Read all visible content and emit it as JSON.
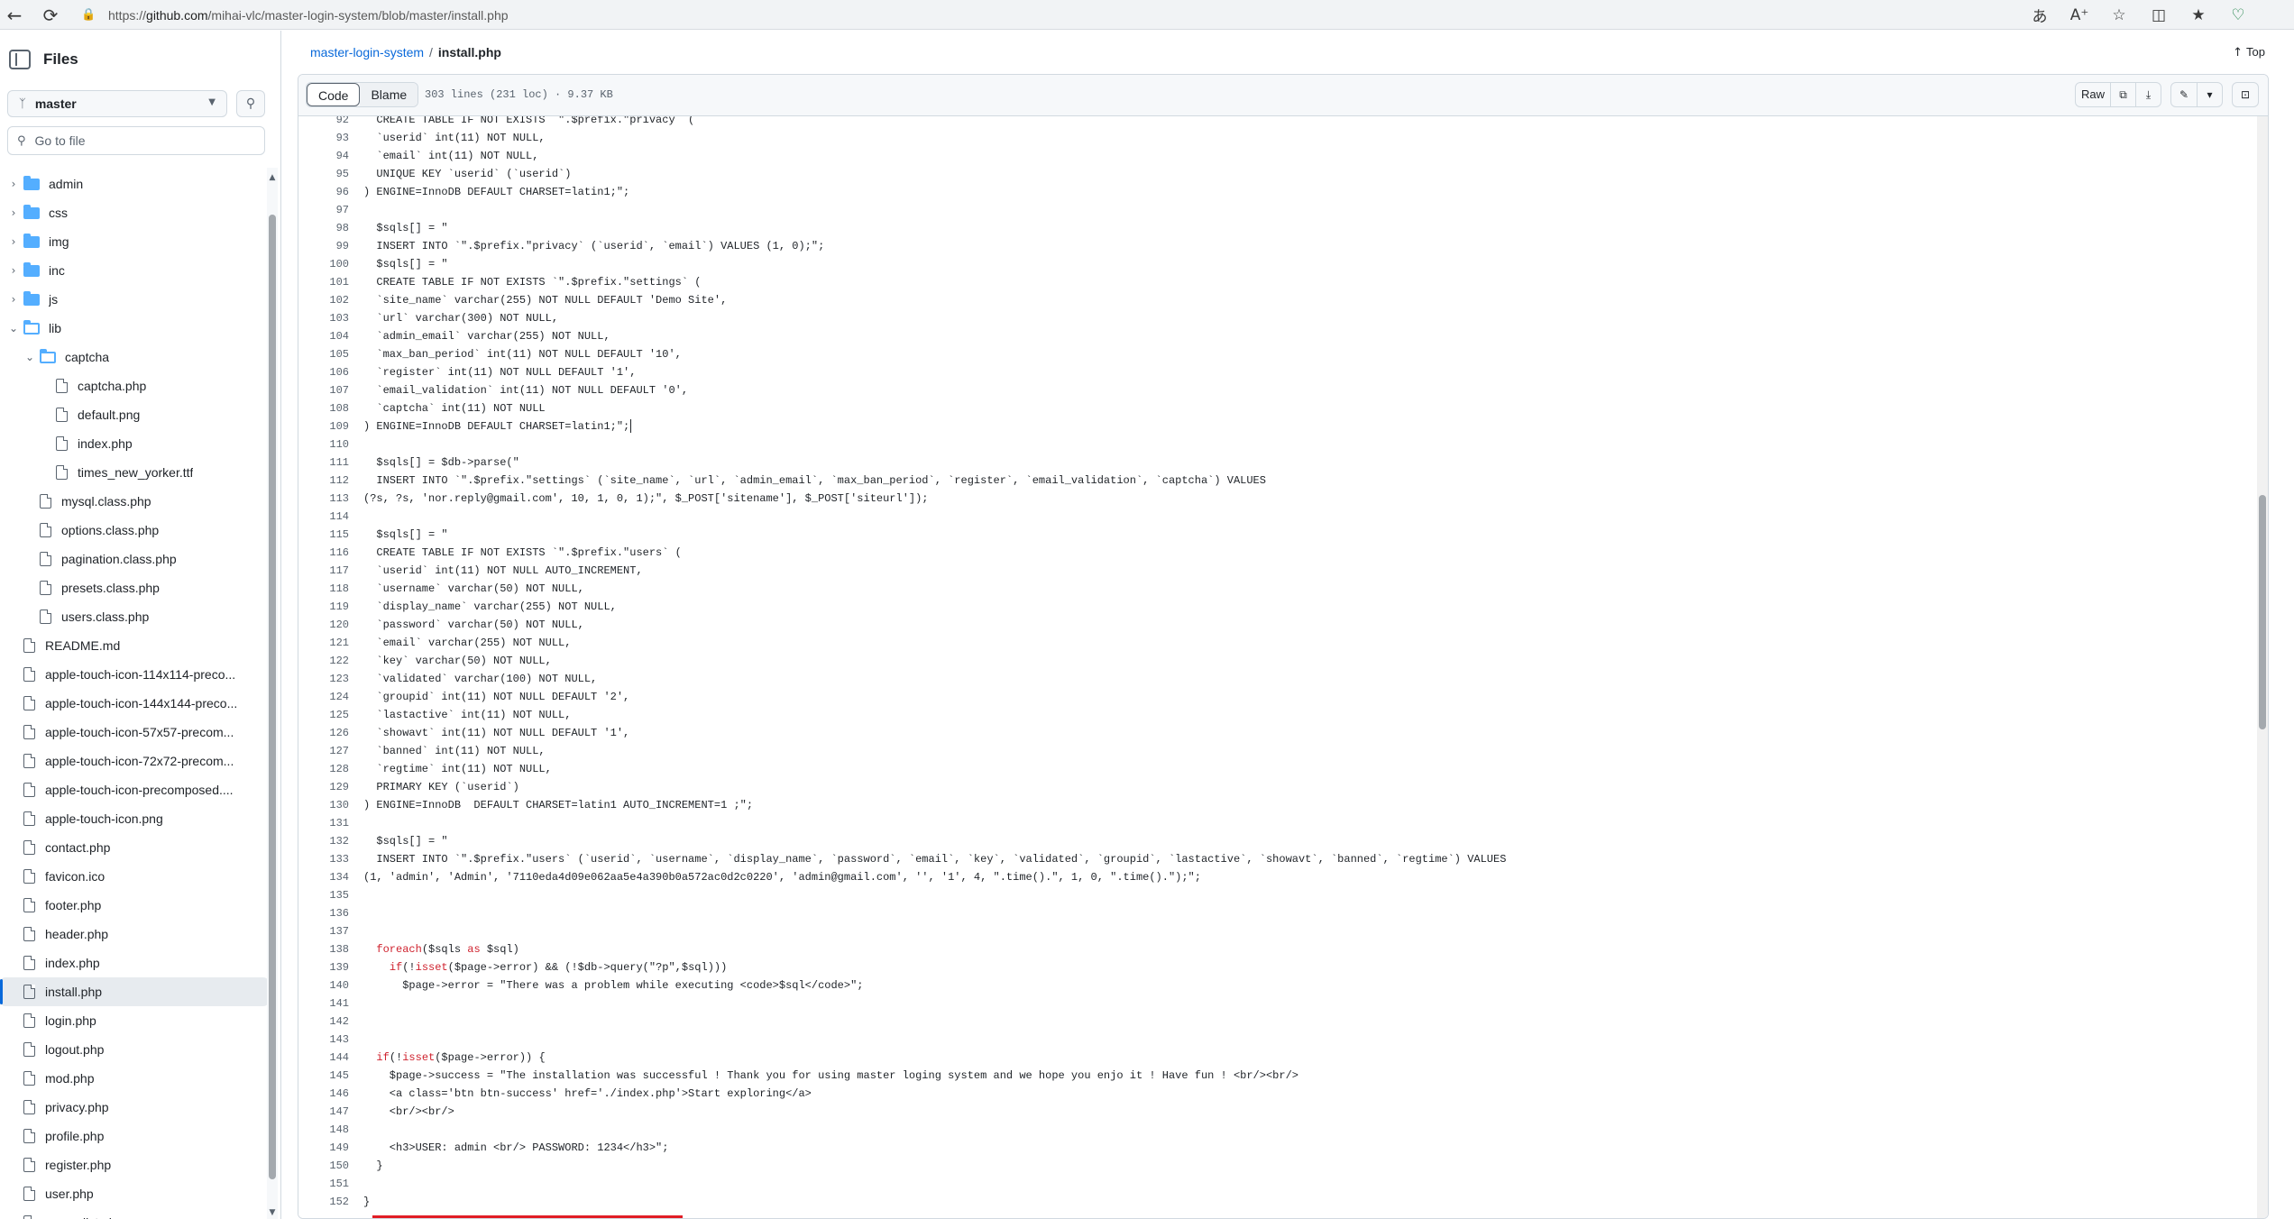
{
  "browser": {
    "url_prefix": "https://",
    "url_host": "github.com",
    "url_path": "/mihai-vlc/master-login-system/blob/master/install.php"
  },
  "sidebar": {
    "title": "Files",
    "branch": "master",
    "goto_placeholder": "Go to file",
    "items": [
      {
        "label": "admin",
        "type": "folder",
        "depth": 0,
        "expanded": false
      },
      {
        "label": "css",
        "type": "folder",
        "depth": 0,
        "expanded": false
      },
      {
        "label": "img",
        "type": "folder",
        "depth": 0,
        "expanded": false
      },
      {
        "label": "inc",
        "type": "folder",
        "depth": 0,
        "expanded": false
      },
      {
        "label": "js",
        "type": "folder",
        "depth": 0,
        "expanded": false
      },
      {
        "label": "lib",
        "type": "folder",
        "depth": 0,
        "expanded": true
      },
      {
        "label": "captcha",
        "type": "folder",
        "depth": 1,
        "expanded": true
      },
      {
        "label": "captcha.php",
        "type": "file",
        "depth": 2
      },
      {
        "label": "default.png",
        "type": "file",
        "depth": 2
      },
      {
        "label": "index.php",
        "type": "file",
        "depth": 2
      },
      {
        "label": "times_new_yorker.ttf",
        "type": "file",
        "depth": 2
      },
      {
        "label": "mysql.class.php",
        "type": "file",
        "depth": 1
      },
      {
        "label": "options.class.php",
        "type": "file",
        "depth": 1
      },
      {
        "label": "pagination.class.php",
        "type": "file",
        "depth": 1
      },
      {
        "label": "presets.class.php",
        "type": "file",
        "depth": 1
      },
      {
        "label": "users.class.php",
        "type": "file",
        "depth": 1
      },
      {
        "label": "README.md",
        "type": "file",
        "depth": 0
      },
      {
        "label": "apple-touch-icon-114x114-preco...",
        "type": "file",
        "depth": 0
      },
      {
        "label": "apple-touch-icon-144x144-preco...",
        "type": "file",
        "depth": 0
      },
      {
        "label": "apple-touch-icon-57x57-precom...",
        "type": "file",
        "depth": 0
      },
      {
        "label": "apple-touch-icon-72x72-precom...",
        "type": "file",
        "depth": 0
      },
      {
        "label": "apple-touch-icon-precomposed....",
        "type": "file",
        "depth": 0
      },
      {
        "label": "apple-touch-icon.png",
        "type": "file",
        "depth": 0
      },
      {
        "label": "contact.php",
        "type": "file",
        "depth": 0
      },
      {
        "label": "favicon.ico",
        "type": "file",
        "depth": 0
      },
      {
        "label": "footer.php",
        "type": "file",
        "depth": 0
      },
      {
        "label": "header.php",
        "type": "file",
        "depth": 0
      },
      {
        "label": "index.php",
        "type": "file",
        "depth": 0
      },
      {
        "label": "install.php",
        "type": "file",
        "depth": 0,
        "active": true
      },
      {
        "label": "login.php",
        "type": "file",
        "depth": 0
      },
      {
        "label": "logout.php",
        "type": "file",
        "depth": 0
      },
      {
        "label": "mod.php",
        "type": "file",
        "depth": 0
      },
      {
        "label": "privacy.php",
        "type": "file",
        "depth": 0
      },
      {
        "label": "profile.php",
        "type": "file",
        "depth": 0
      },
      {
        "label": "register.php",
        "type": "file",
        "depth": 0
      },
      {
        "label": "user.php",
        "type": "file",
        "depth": 0
      },
      {
        "label": "users_list.php",
        "type": "file",
        "depth": 0
      }
    ]
  },
  "breadcrumb": {
    "repo": "master-login-system",
    "separator": "/",
    "file": "install.php"
  },
  "top_link": "Top",
  "file_header": {
    "tab_code": "Code",
    "tab_blame": "Blame",
    "meta": "303 lines (231 loc) · 9.37 KB",
    "raw_label": "Raw"
  },
  "code": {
    "first_line": 92,
    "lines": [
      "  CREATE TABLE IF NOT EXISTS `\".$prefix.\"privacy` (",
      "  `userid` int(11) NOT NULL,",
      "  `email` int(11) NOT NULL,",
      "  UNIQUE KEY `userid` (`userid`)",
      ") ENGINE=InnoDB DEFAULT CHARSET=latin1;\";",
      "",
      "  $sqls[] = \"",
      "  INSERT INTO `\".$prefix.\"privacy` (`userid`, `email`) VALUES (1, 0);\";",
      "  $sqls[] = \"",
      "  CREATE TABLE IF NOT EXISTS `\".$prefix.\"settings` (",
      "  `site_name` varchar(255) NOT NULL DEFAULT 'Demo Site',",
      "  `url` varchar(300) NOT NULL,",
      "  `admin_email` varchar(255) NOT NULL,",
      "  `max_ban_period` int(11) NOT NULL DEFAULT '10',",
      "  `register` int(11) NOT NULL DEFAULT '1',",
      "  `email_validation` int(11) NOT NULL DEFAULT '0',",
      "  `captcha` int(11) NOT NULL",
      ") ENGINE=InnoDB DEFAULT CHARSET=latin1;\";",
      "",
      "  $sqls[] = $db->parse(\"",
      "  INSERT INTO `\".$prefix.\"settings` (`site_name`, `url`, `admin_email`, `max_ban_period`, `register`, `email_validation`, `captcha`) VALUES",
      "(?s, ?s, 'nor.reply@gmail.com', 10, 1, 0, 1);\", $_POST['sitename'], $_POST['siteurl']);",
      "",
      "  $sqls[] = \"",
      "  CREATE TABLE IF NOT EXISTS `\".$prefix.\"users` (",
      "  `userid` int(11) NOT NULL AUTO_INCREMENT,",
      "  `username` varchar(50) NOT NULL,",
      "  `display_name` varchar(255) NOT NULL,",
      "  `password` varchar(50) NOT NULL,",
      "  `email` varchar(255) NOT NULL,",
      "  `key` varchar(50) NOT NULL,",
      "  `validated` varchar(100) NOT NULL,",
      "  `groupid` int(11) NOT NULL DEFAULT '2',",
      "  `lastactive` int(11) NOT NULL,",
      "  `showavt` int(11) NOT NULL DEFAULT '1',",
      "  `banned` int(11) NOT NULL,",
      "  `regtime` int(11) NOT NULL,",
      "  PRIMARY KEY (`userid`)",
      ") ENGINE=InnoDB  DEFAULT CHARSET=latin1 AUTO_INCREMENT=1 ;\";",
      "",
      "  $sqls[] = \"",
      "  INSERT INTO `\".$prefix.\"users` (`userid`, `username`, `display_name`, `password`, `email`, `key`, `validated`, `groupid`, `lastactive`, `showavt`, `banned`, `regtime`) VALUES",
      "(1, 'admin', 'Admin', '7110eda4d09e062aa5e4a390b0a572ac0d2c0220', 'admin@gmail.com', '', '1', 4, \".time().\", 1, 0, \".time().\");\";",
      "",
      "",
      "",
      "  foreach($sqls as $sql)",
      "    if(!isset($page->error) && (!$db->query(\"?p\",$sql)))",
      "      $page->error = \"There was a problem while executing <code>$sql</code>\";",
      "",
      "",
      "",
      "  if(!isset($page->error)) {",
      "    $page->success = \"The installation was successful ! Thank you for using master loging system and we hope you enjo it ! Have fun ! <br/><br/>",
      "    <a class='btn btn-success' href='./index.php'>Start exploring</a>",
      "    <br/><br/>",
      "",
      "    <h3>USER: admin <br/> PASSWORD: 1234</h3>\";",
      "  }",
      "",
      "}"
    ]
  },
  "colors": {
    "accent": "#0969da",
    "highlight_box": "#e11d25",
    "keyword": "#cf222e",
    "function": "#8250df"
  }
}
